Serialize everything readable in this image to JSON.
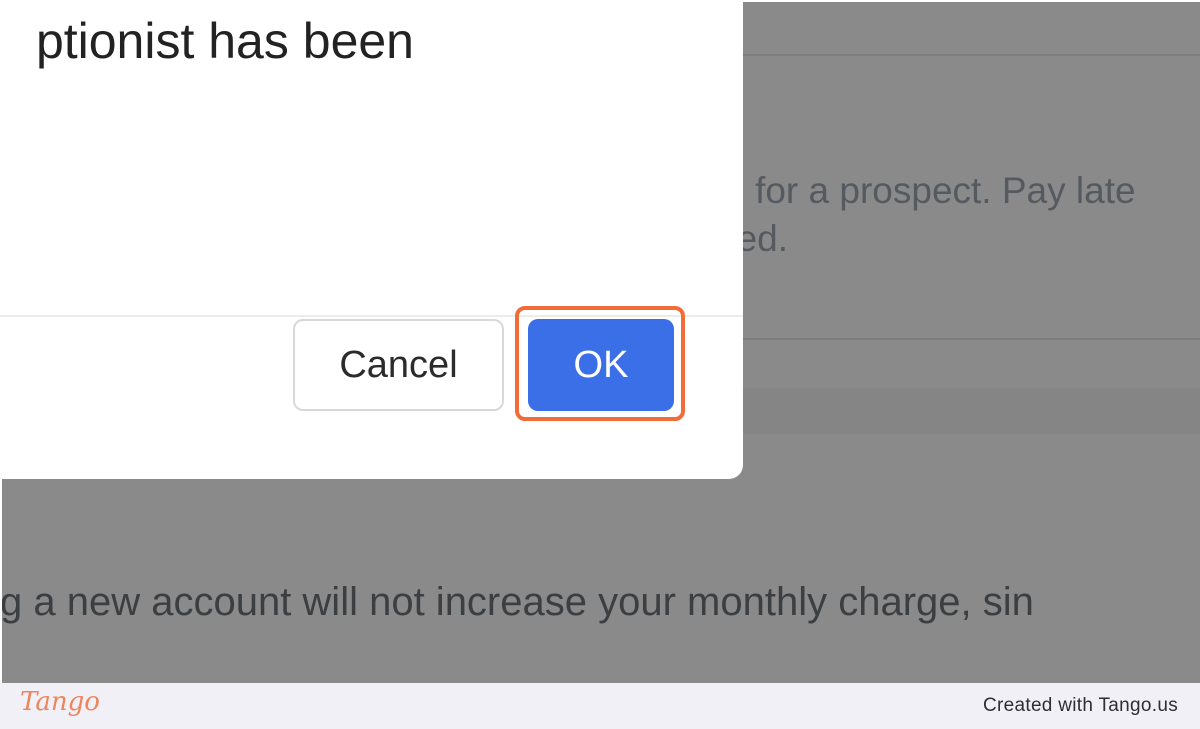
{
  "background": {
    "line1": "al for a prospect. Pay late",
    "line2": "ned.",
    "line3": "g a new account will not increase your monthly charge, sin"
  },
  "dialog": {
    "title": "ptionist has been",
    "cancel_label": "Cancel",
    "ok_label": "OK"
  },
  "footer": {
    "logo": "Tango",
    "credit": "Created with Tango.us"
  },
  "colors": {
    "primary_button": "#3b6fe8",
    "highlight": "#f26b3a",
    "overlay": "#8a8a8a"
  }
}
